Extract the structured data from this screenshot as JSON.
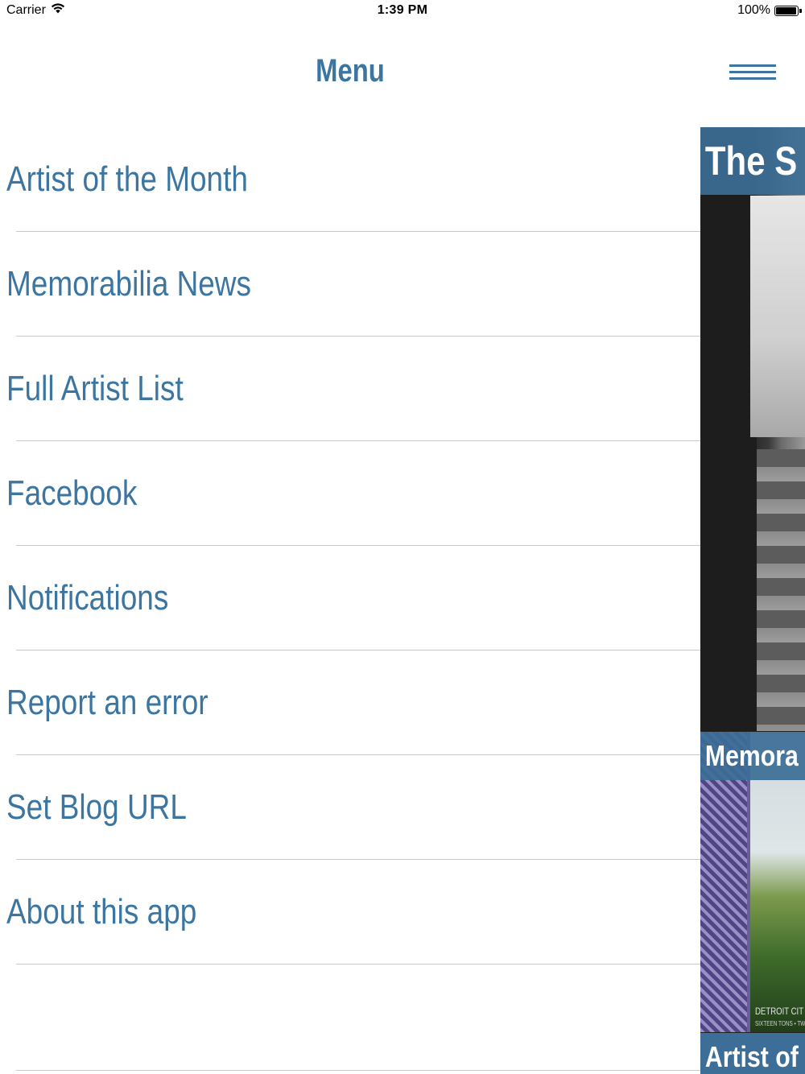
{
  "status_bar": {
    "carrier": "Carrier",
    "time": "1:39 PM",
    "battery_text": "100%",
    "battery_level_percent": 100
  },
  "nav": {
    "title": "Menu",
    "menu_icon": "hamburger-icon"
  },
  "menu": {
    "items": [
      {
        "label": "Artist of the Month"
      },
      {
        "label": "Memorabilia News"
      },
      {
        "label": "Full Artist List"
      },
      {
        "label": "Facebook"
      },
      {
        "label": "Notifications"
      },
      {
        "label": "Report an error"
      },
      {
        "label": "Set Blog URL"
      },
      {
        "label": "About this app"
      }
    ]
  },
  "content_peek": {
    "tiles": [
      {
        "title": "The S"
      },
      {
        "title": "Memora",
        "caption": "DETROIT CIT",
        "caption_sub": "SIXTEEN TONS • TW"
      },
      {
        "title": "Artist of"
      }
    ]
  },
  "colors": {
    "accent": "#3c76a0",
    "divider": "#c8c8c8",
    "background": "#ffffff"
  }
}
